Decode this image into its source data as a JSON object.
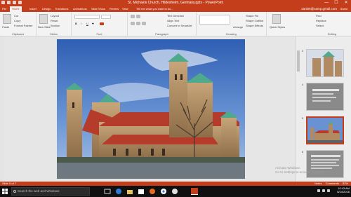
{
  "window": {
    "title": "St. Michaels Church, Hildesheim, Germany.pptx - PowerPoint",
    "minimize": "—",
    "maximize": "☐",
    "close": "✕"
  },
  "ribbon_tabs": [
    "File",
    "Home",
    "Insert",
    "Design",
    "Transitions",
    "Animations",
    "Slide Show",
    "Review",
    "View",
    "Tell me what you want to do..."
  ],
  "account": {
    "user": "sanket@samp.gmail.com",
    "share": "Share"
  },
  "ribbon": {
    "clipboard": {
      "label": "Clipboard",
      "paste": "Paste",
      "cut": "Cut",
      "copy": "Copy",
      "format_painter": "Format Painter"
    },
    "slides": {
      "label": "Slides",
      "new_slide": "New Slide",
      "layout": "Layout",
      "reset": "Reset",
      "section": "Section"
    },
    "font": {
      "label": "Font",
      "bold": "B",
      "italic": "I",
      "underline": "U",
      "strike": "S"
    },
    "paragraph": {
      "label": "Paragraph",
      "text_direction": "Text Direction",
      "align_text": "Align Text",
      "convert": "Convert to SmartArt"
    },
    "drawing": {
      "label": "Drawing",
      "arrange": "Arrange",
      "quick_styles": "Quick Styles",
      "shape_fill": "Shape Fill",
      "shape_outline": "Shape Outline",
      "shape_effects": "Shape Effects"
    },
    "editing": {
      "label": "Editing",
      "find": "Find",
      "replace": "Replace",
      "select": "Select"
    }
  },
  "thumbnails": [
    {
      "num": "3",
      "selected": false
    },
    {
      "num": "4",
      "selected": false
    },
    {
      "num": "5",
      "selected": true
    },
    {
      "num": "6",
      "selected": false
    }
  ],
  "watermark": {
    "line1": "Activate Windows",
    "line2": "Go to Settings to activate Windows."
  },
  "status": {
    "slide": "Slide 5 of 7",
    "notes": "Notes",
    "comments": "Comments",
    "zoom": "82%"
  },
  "taskbar": {
    "search_placeholder": "Search the web and Windows",
    "time": "10:43 AM",
    "date": "6/24/2016"
  },
  "colors": {
    "accent": "#c43e1c",
    "taskbar": "#101010",
    "ribbon": "#f3f3f3"
  }
}
